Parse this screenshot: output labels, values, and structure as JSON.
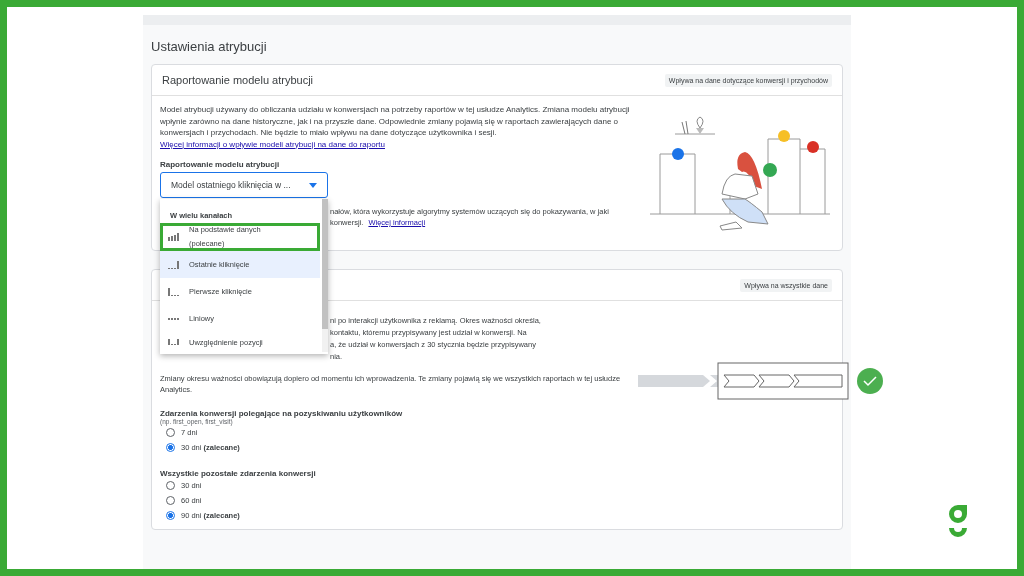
{
  "page_title": "Ustawienia atrybucji",
  "attribution_card": {
    "title": "Raportowanie modelu atrybucji",
    "chip": "Wpływa na dane dotyczące konwersji i przychodów",
    "description": "Model atrybucji używany do obliczania udziału w konwersjach na potrzeby raportów w tej usłudze Analytics. Zmiana modelu atrybucji wpłynie zarówno na dane historyczne, jak i na przyszłe dane. Odpowiednie zmiany pojawią się w raportach zawierających dane o konwersjach i przychodach. Nie będzie to miało wpływu na dane dotyczące użytkownika i sesji.",
    "link": "Więcej informacji o wpływie modeli atrybucji na dane do raportu",
    "field_label": "Raportowanie modelu atrybucji",
    "select_value": "Model ostatniego kliknięcia w ...",
    "partial_lines": [
      "nałów, która wykorzystuje algorytmy systemów uczących się do pokazywania, w jaki",
      "konwersji."
    ],
    "partial_link": "Więcej informacji"
  },
  "dropdown": {
    "group": "W wielu kanałach",
    "items": [
      {
        "label": "Na podstawie danych (polecane)",
        "selected": false,
        "annotated": true
      },
      {
        "label": "Ostatnie kliknięcie",
        "selected": true,
        "annotated": false
      },
      {
        "label": "Pierwsze kliknięcie",
        "selected": false,
        "annotated": false
      },
      {
        "label": "Liniowy",
        "selected": false,
        "annotated": false
      },
      {
        "label": "Uwzględnienie pozycji",
        "selected": false,
        "annotated": false
      }
    ]
  },
  "lookback_card": {
    "chip": "Wpływa na wszystkie dane",
    "partial_lines": [
      "ni po interakcji użytkownika z reklamą. Okres ważności określa,",
      "kontaktu, któremu przypisywany jest udział w konwersji. Na",
      "a, że udział w konwersjach z 30 stycznia będzie przypisywany",
      "nia."
    ],
    "note": "Zmiany okresu ważności obowiązują dopiero od momentu ich wprowadzenia. Te zmiany pojawią się we wszystkich raportach w tej usłudze Analytics.",
    "groups": [
      {
        "title": "Zdarzenia konwersji polegające na pozyskiwaniu użytkowników",
        "hint": "(np. first_open, first_visit)",
        "options": [
          {
            "label": "7 dni",
            "selected": false
          },
          {
            "label": "30 dni **(zalecane)**",
            "selected": true
          }
        ]
      },
      {
        "title": "Wszystkie pozostałe zdarzenia konwersji",
        "options": [
          {
            "label": "30 dni",
            "selected": false
          },
          {
            "label": "60 dni",
            "selected": false
          },
          {
            "label": "90 dni **(zalecane)**",
            "selected": true
          }
        ]
      }
    ]
  }
}
